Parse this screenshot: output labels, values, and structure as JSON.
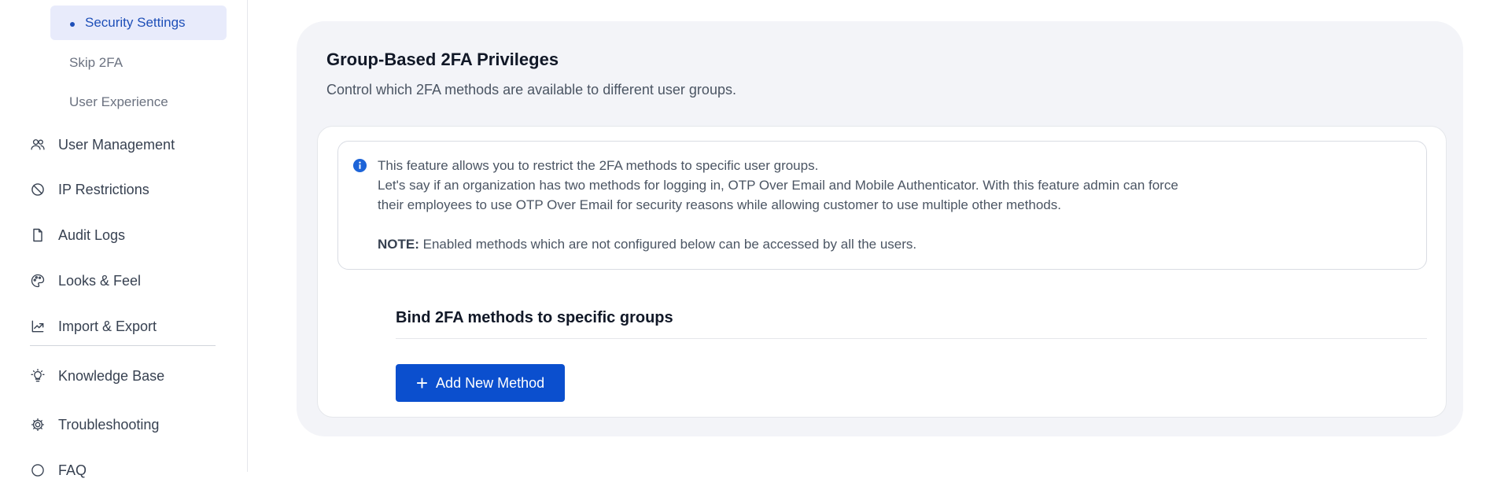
{
  "sidebar": {
    "sub_items": [
      {
        "label": "Security Settings",
        "active": true
      },
      {
        "label": "Skip 2FA",
        "active": false
      },
      {
        "label": "User Experience",
        "active": false
      }
    ],
    "nav_items": [
      {
        "label": "User Management",
        "icon": "users-icon"
      },
      {
        "label": "IP Restrictions",
        "icon": "ban-icon"
      },
      {
        "label": "Audit Logs",
        "icon": "document-icon"
      },
      {
        "label": "Looks & Feel",
        "icon": "palette-icon"
      },
      {
        "label": "Import & Export",
        "icon": "export-icon"
      },
      {
        "label": "Knowledge Base",
        "icon": "lightbulb-icon"
      },
      {
        "label": "Troubleshooting",
        "icon": "gear-icon"
      },
      {
        "label": "FAQ",
        "icon": "question-icon"
      }
    ]
  },
  "main": {
    "title": "Group-Based 2FA Privileges",
    "subtitle": "Control which 2FA methods are available to different user groups.",
    "info": {
      "line1": "This feature allows you to restrict the 2FA methods to specific user groups.",
      "line2": "Let's say if an organization has two methods for logging in, OTP Over Email and Mobile Authenticator. With this feature admin can force",
      "line3": "their employees to use OTP Over Email for security reasons while allowing customer to use multiple other methods.",
      "note_label": "NOTE:",
      "note_text": "Enabled methods which are not configured below can be accessed by all the users."
    },
    "bind_title": "Bind 2FA methods to specific groups",
    "add_button": "Add New Method"
  },
  "colors": {
    "accent": "#0b4fce",
    "active_bg": "#e8ebfb",
    "active_text": "#1e4fb8",
    "card_bg": "#f3f4f8"
  }
}
